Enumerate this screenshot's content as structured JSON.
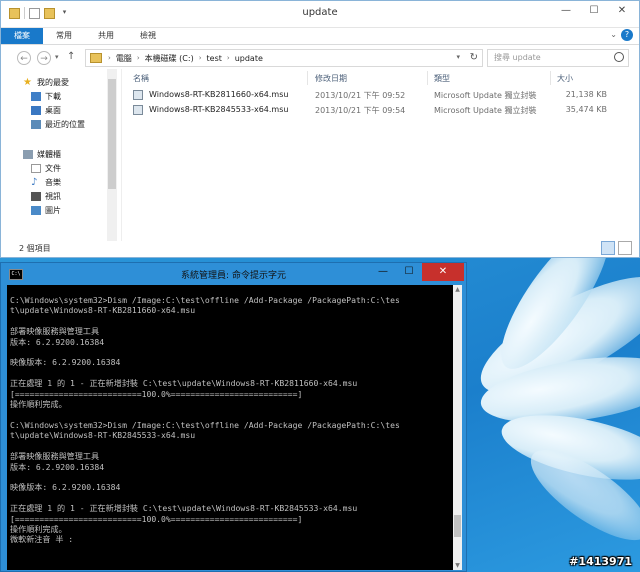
{
  "explorer": {
    "title": "update",
    "ribbon_tabs": [
      "檔案",
      "常用",
      "共用",
      "檢視"
    ],
    "address": {
      "crumbs": [
        "電腦",
        "本機磁碟 (C:)",
        "test",
        "update"
      ]
    },
    "search_placeholder": "搜尋 update",
    "nav": {
      "favorites": "我的最愛",
      "items_fav": [
        "下載",
        "桌面",
        "最近的位置"
      ],
      "libraries": "媒體櫃",
      "items_lib": [
        "文件",
        "音樂",
        "視訊",
        "圖片"
      ]
    },
    "columns": [
      "名稱",
      "修改日期",
      "類型",
      "大小"
    ],
    "files": [
      {
        "name": "Windows8-RT-KB2811660-x64.msu",
        "date": "2013/10/21 下午 09:52",
        "type": "Microsoft Update 獨立封裝",
        "size": "21,138 KB"
      },
      {
        "name": "Windows8-RT-KB2845533-x64.msu",
        "date": "2013/10/21 下午 09:54",
        "type": "Microsoft Update 獨立封裝",
        "size": "35,474 KB"
      }
    ],
    "status_count": "2 個項目"
  },
  "cmd": {
    "title": "系統管理員: 命令提示字元",
    "icon_text": "C:\\",
    "lines": [
      "C:\\Windows\\system32>Dism /Image:C:\\test\\offline /Add-Package /PackagePath:C:\\tes",
      "t\\update\\Windows8-RT-KB2811660-x64.msu",
      "",
      "部署映像服務與管理工具",
      "版本: 6.2.9200.16384",
      "",
      "映像版本: 6.2.9200.16384",
      "",
      "正在處理 1 的 1 - 正在新增封裝 C:\\test\\update\\Windows8-RT-KB2811660-x64.msu",
      "[==========================100.0%==========================]",
      "操作順利完成。",
      "",
      "C:\\Windows\\system32>Dism /Image:C:\\test\\offline /Add-Package /PackagePath:C:\\tes",
      "t\\update\\Windows8-RT-KB2845533-x64.msu",
      "",
      "部署映像服務與管理工具",
      "版本: 6.2.9200.16384",
      "",
      "映像版本: 6.2.9200.16384",
      "",
      "正在處理 1 的 1 - 正在新增封裝 C:\\test\\update\\Windows8-RT-KB2845533-x64.msu",
      "[==========================100.0%==========================]",
      "操作順利完成。",
      "微軟新注音 半 :"
    ]
  },
  "watermark": "#1413971"
}
